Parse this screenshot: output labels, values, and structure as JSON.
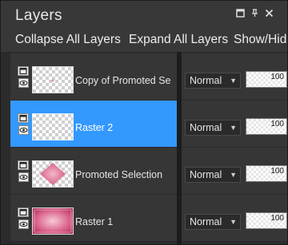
{
  "panel": {
    "title": "Layers",
    "window_icons": [
      "maximize-icon",
      "pin-icon",
      "close-icon"
    ]
  },
  "toolbar": {
    "collapse_label": "Collapse All Layers",
    "expand_label": "Expand All Layers",
    "show_hide_label": "Show/Hid"
  },
  "layers": [
    {
      "name": "Copy of Promoted Se",
      "blend_mode": "Normal",
      "opacity": "100",
      "selected": false
    },
    {
      "name": "Raster 2",
      "blend_mode": "Normal",
      "opacity": "100",
      "selected": true
    },
    {
      "name": "Promoted Selection",
      "blend_mode": "Normal",
      "opacity": "100",
      "selected": false
    },
    {
      "name": "Raster 1",
      "blend_mode": "Normal",
      "opacity": "100",
      "selected": false
    }
  ],
  "colors": {
    "selection": "#3399ff",
    "panel_bg": "#353535",
    "pink": "#e0789a"
  }
}
